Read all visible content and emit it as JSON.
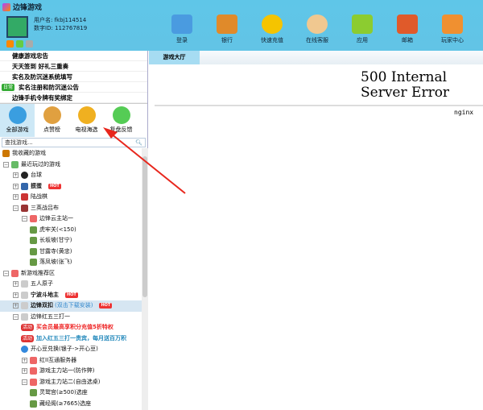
{
  "app": {
    "title": "边锋游戏"
  },
  "user": {
    "username_label": "用户名:",
    "username": "fkbj114514",
    "id_label": "数字ID:",
    "id": "112767819"
  },
  "toolbar": [
    {
      "label": "登录",
      "color": "#4a9be0"
    },
    {
      "label": "银行",
      "color": "#e08a2a"
    },
    {
      "label": "快速充值",
      "color": "#f5c400"
    },
    {
      "label": "在线客服",
      "color": "#f0c890"
    },
    {
      "label": "应用",
      "color": "#8ccc30"
    },
    {
      "label": "邮箱",
      "color": "#e05a2a"
    },
    {
      "label": "玩家中心",
      "color": "#f09030"
    }
  ],
  "notices": [
    "健康游戏忠告",
    "天天签到 好礼三重奏",
    "实名及防沉迷系统填写",
    "实名注册和防沉迷公告",
    "边锋手机令牌有奖绑定"
  ],
  "notice_tag": "日常",
  "categories": [
    "全部游戏",
    "点赞榜",
    "电视海选",
    "复盘反馈"
  ],
  "search": {
    "placeholder": "查找游戏..."
  },
  "tree": {
    "favorites": "我收藏的游戏",
    "recent": "最近玩过的游戏",
    "taiqiu": "台球",
    "guandan": "掼蛋",
    "hot": "HOT",
    "luzhanqi": "陆战棋",
    "sanying": "三英战吕布",
    "server1": "边锋云主站一",
    "r1": "虎牢关(<150)",
    "r2": "长坂坡(甘宁)",
    "r3": "甘露寺(黄忠)",
    "r4": "落凤坡(张飞)",
    "newgames": "新游戏推荐区",
    "wuren": "五人原子",
    "ningbo": "宁波斗地主",
    "shuangkou": "边锋双扣",
    "shuangkou_note": "(双击下载安装)",
    "hongwu": "边锋红五三打一",
    "act_tag": "活动",
    "act1": "买会员最高享积分充值5折特权",
    "act2": "加入红五三打一贵宾，每月送百万积",
    "exchange": "开心豆兑换(银子->开心豆)",
    "s1": "红ⅠⅠ互通服务器",
    "s2": "游戏主力站一(防作弊)",
    "s3": "游戏主力站二(自由选桌)",
    "room1": "灵鹫宫(≥500)选座",
    "room2": "藏经阁(≥7665)选座"
  },
  "tabs": {
    "hall": "游戏大厅"
  },
  "content": {
    "error": "500 Internal Server Error",
    "server": "nginx"
  }
}
